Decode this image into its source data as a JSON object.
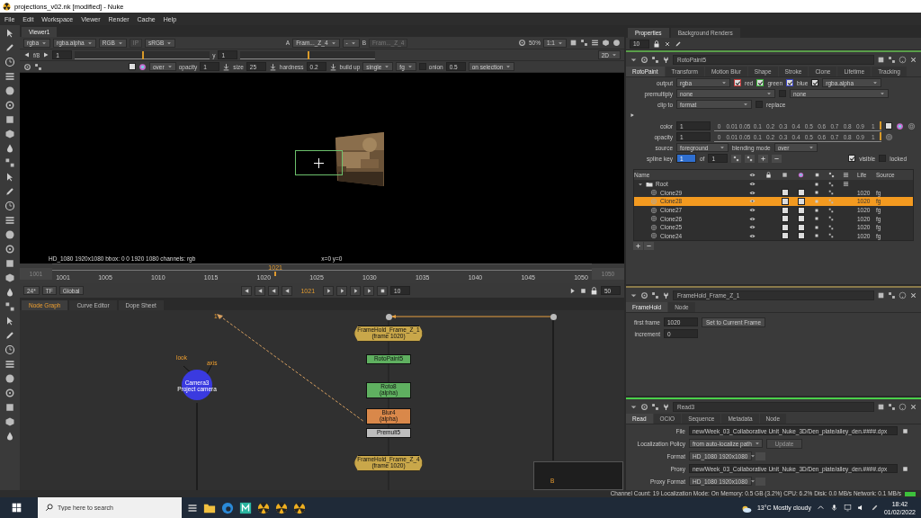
{
  "window": {
    "title": "projections_v02.nk [modified] - Nuke"
  },
  "menu": [
    "File",
    "Edit",
    "Workspace",
    "Viewer",
    "Render",
    "Cache",
    "Help"
  ],
  "viewer": {
    "tabs": [
      {
        "label": "Viewer1",
        "selected": true
      }
    ],
    "row1": {
      "left": [
        {
          "kind": "dropdown",
          "text": "rgba"
        },
        {
          "kind": "dropdown",
          "text": "rgba.alpha"
        },
        {
          "kind": "dropdown",
          "text": "RGB"
        },
        {
          "kind": "dim",
          "text": "IP"
        },
        {
          "kind": "dropdown",
          "text": "sRGB"
        }
      ],
      "center": [
        {
          "kind": "label",
          "text": "A"
        },
        {
          "kind": "dropdown",
          "text": "Fram..._Z_4"
        },
        {
          "kind": "dropdown",
          "text": "-"
        },
        {
          "kind": "label",
          "text": "B"
        },
        {
          "kind": "dim",
          "text": "Fram..._Z_4"
        }
      ],
      "right": [
        {
          "kind": "label",
          "text": "50%"
        },
        {
          "kind": "dropdown",
          "text": "1:1"
        }
      ]
    },
    "row2": {
      "left": [
        {
          "kind": "stepper",
          "text": "f/8"
        },
        {
          "kind": "field",
          "text": "1"
        },
        {
          "kind": "ruler",
          "level": 0.5
        },
        {
          "kind": "label",
          "text": "y"
        },
        {
          "kind": "field",
          "text": "1"
        },
        {
          "kind": "ruler",
          "level": 0.5
        }
      ],
      "right": [
        {
          "kind": "dropdown",
          "text": "2D"
        }
      ]
    },
    "row3": {
      "left": [
        {
          "kind": "swatch"
        },
        {
          "kind": "dropdown",
          "text": "over"
        },
        {
          "kind": "label",
          "text": "opacity"
        },
        {
          "kind": "field",
          "text": "1"
        },
        {
          "kind": "tool",
          "text": "size"
        },
        {
          "kind": "field",
          "text": "25"
        },
        {
          "kind": "tool",
          "text": "hardness"
        },
        {
          "kind": "field",
          "text": "0.2"
        },
        {
          "kind": "tool",
          "text": "build up"
        },
        {
          "kind": "dropdown",
          "text": "single"
        },
        {
          "kind": "dropdown",
          "text": "fg"
        },
        {
          "kind": "check",
          "checked": false
        },
        {
          "kind": "label",
          "text": "onion"
        },
        {
          "kind": "field",
          "text": "0.5"
        },
        {
          "kind": "dropdown",
          "text": "on selection"
        }
      ]
    },
    "info": {
      "format": "HD_1080 1920x1080  bbox: 0 0 1920 1080 channels: rgb",
      "coords": "x=0 y=0"
    },
    "timeline": {
      "start": "1001",
      "end": "1050",
      "ticks": [
        "1001",
        "1005",
        "1010",
        "1015",
        "1020",
        "1025",
        "1030",
        "1035",
        "1040",
        "1045",
        "1050"
      ],
      "current": "1021",
      "level": 0.41
    },
    "playback": {
      "fps": "24*",
      "tf": "TF",
      "scope": "Global",
      "frame": "1021",
      "step": "10",
      "end": "50"
    }
  },
  "node_graph": {
    "tabs": [
      {
        "label": "Node Graph",
        "selected": true
      },
      {
        "label": "Curve Editor",
        "selected": false
      },
      {
        "label": "Dope Sheet",
        "selected": false
      }
    ],
    "nodes": [
      {
        "kind": "framehold",
        "label": "FrameHold_Frame_Z_1",
        "sub": "(frame 1020)",
        "color": "#c9a74a"
      },
      {
        "kind": "node",
        "label": "RotoPaint5",
        "color": "#5fb060"
      },
      {
        "kind": "node",
        "label": "Roto8",
        "sub": "(alpha)",
        "color": "#5fb060"
      },
      {
        "kind": "node",
        "label": "Blur4",
        "sub": "(alpha)",
        "color": "#d9884a"
      },
      {
        "kind": "node",
        "label": "Premult5",
        "color": "#bdbdbd"
      },
      {
        "kind": "framehold",
        "label": "FrameHold_Frame_Z_4",
        "sub": "(frame 1020)",
        "color": "#c9a74a"
      },
      {
        "kind": "tag",
        "label": "1"
      },
      {
        "kind": "tag",
        "label": "look"
      },
      {
        "kind": "tag",
        "label": "axis"
      },
      {
        "kind": "camera",
        "label": "Camera3",
        "sub": "Project camera",
        "color": "#3a3ae0"
      },
      {
        "kind": "tag",
        "label": "B"
      }
    ]
  },
  "properties": {
    "tabs": [
      {
        "label": "Properties",
        "selected": true
      },
      {
        "label": "Background Renders",
        "selected": false
      }
    ],
    "count": "10",
    "rotopaint": {
      "name": "RotoPaint5",
      "tabs": [
        {
          "label": "RotoPaint",
          "selected": true
        },
        {
          "label": "Transform",
          "selected": false
        },
        {
          "label": "Motion Blur",
          "selected": false
        },
        {
          "label": "Shape",
          "selected": false
        },
        {
          "label": "Stroke",
          "selected": false
        },
        {
          "label": "Clone",
          "selected": false
        },
        {
          "label": "Lifetime",
          "selected": false
        },
        {
          "label": "Tracking",
          "selected": false
        }
      ],
      "output": {
        "label": "output",
        "value": "rgba"
      },
      "channels": [
        {
          "label": "red",
          "checked": true,
          "color": "#c83c3c"
        },
        {
          "label": "green",
          "checked": true,
          "color": "#3cb43c"
        },
        {
          "label": "blue",
          "checked": true,
          "color": "#3c46c8"
        }
      ],
      "alpha": {
        "checked": true,
        "value": "rgba.alpha"
      },
      "premultiply": {
        "label": "premultiply",
        "value": "none",
        "checked": false,
        "value_2": "none"
      },
      "clip_to": {
        "label": "clip to",
        "value": "format",
        "replace_label": "replace",
        "replace": false
      },
      "color": {
        "label": "color",
        "value": "1",
        "level": 1,
        "ticks": [
          "0",
          "0.01",
          "0.05",
          "0.1",
          "0.2",
          "0.3",
          "0.4",
          "0.5",
          "0.6",
          "0.7",
          "0.8",
          "0.9",
          "1"
        ]
      },
      "opacity": {
        "label": "opacity",
        "value": "1",
        "level": 1,
        "ticks": [
          "0",
          "0.01",
          "0.05",
          "0.1",
          "0.2",
          "0.3",
          "0.4",
          "0.5",
          "0.6",
          "0.7",
          "0.8",
          "0.9",
          "1"
        ]
      },
      "source": {
        "label": "source",
        "value": "foreground",
        "mode_label": "blending mode",
        "mode": "over"
      },
      "spline_key": {
        "label": "spline key",
        "value": "1",
        "of_label": "of",
        "total": "1"
      },
      "visible": {
        "label": "visible",
        "checked": true
      },
      "locked": {
        "label": "locked",
        "checked": false
      },
      "table": {
        "columns": {
          "name": "Name",
          "life": "Life",
          "source": "Source"
        },
        "rows": [
          {
            "name": "Root",
            "expanded": true,
            "selected": false,
            "children": [
              {
                "name": "Clone29",
                "life": "1020",
                "source": "fg",
                "selected": false
              },
              {
                "name": "Clone28",
                "life": "1020",
                "source": "fg",
                "selected": true
              },
              {
                "name": "Clone27",
                "life": "1020",
                "source": "fg",
                "selected": false
              },
              {
                "name": "Clone26",
                "life": "1020",
                "source": "fg",
                "selected": false
              },
              {
                "name": "Clone25",
                "life": "1020",
                "source": "fg",
                "selected": false
              },
              {
                "name": "Clone24",
                "life": "1020",
                "source": "fg",
                "selected": false
              }
            ]
          }
        ]
      }
    },
    "framehold": {
      "name": "FrameHold_Frame_Z_1",
      "tabs": [
        {
          "label": "FrameHold",
          "selected": true
        },
        {
          "label": "Node",
          "selected": false
        }
      ],
      "first_frame": {
        "label": "first frame",
        "value": "1020"
      },
      "set_button": "Set to Current Frame",
      "increment": {
        "label": "increment",
        "value": "0"
      }
    },
    "read": {
      "name": "Read3",
      "tabs": [
        {
          "label": "Read",
          "selected": true
        },
        {
          "label": "OCIO",
          "selected": false
        },
        {
          "label": "Sequence",
          "selected": false
        },
        {
          "label": "Metadata",
          "selected": false
        },
        {
          "label": "Node",
          "selected": false
        }
      ],
      "fields": [
        {
          "kind": "path",
          "label": "File",
          "value": "new/Week_03_Collaborative Unit_Nuke_3D/Den_plate/alley_den.####.dpx"
        },
        {
          "kind": "policy",
          "label": "Localization Policy",
          "value": "from auto-localize path",
          "button": {
            "label": "Update",
            "disabled": true
          }
        },
        {
          "kind": "format",
          "label": "Format",
          "value": "HD_1080 1920x1080"
        },
        {
          "kind": "path",
          "label": "Proxy",
          "value": "new/Week_03_Collaborative Unit_Nuke_3D/Den_plate/alley_den.####.dpx"
        },
        {
          "kind": "format",
          "label": "Proxy Format",
          "value": "HD_1080 1920x1080"
        }
      ]
    }
  },
  "status_bar": "Channel Count: 19  Localization Mode: On Memory: 0.5 GB (3.2%) CPU: 6.2% Disk: 0.0 MB/s Network: 0.1 MB/s",
  "taskbar": {
    "search": {
      "placeholder": "Type here to search"
    },
    "weather": "13°C  Mostly cloudy",
    "time": "18:42",
    "date": "01/02/2022"
  }
}
